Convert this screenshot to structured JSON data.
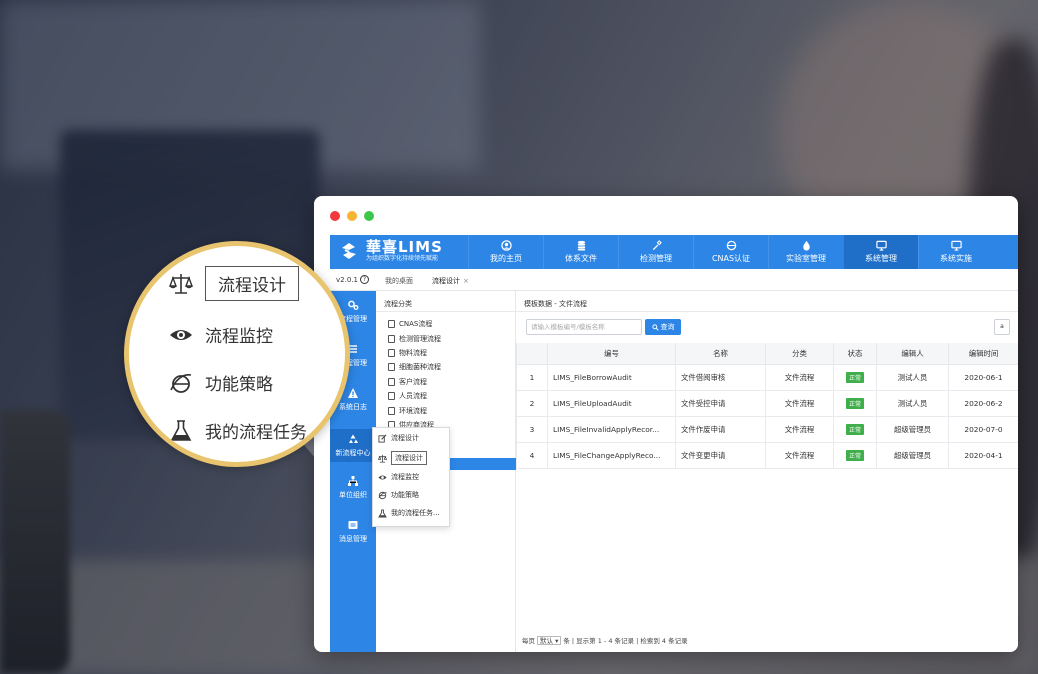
{
  "app": {
    "brand_name": "華喜LIMS",
    "brand_tagline": "为组织数字化持续领先赋能",
    "version": "v2.0.1",
    "help_icon": "?",
    "accent_color": "#2d86e6",
    "status_color": "#3fae4b"
  },
  "nav": [
    {
      "label": "我的主页",
      "icon": "user-icon"
    },
    {
      "label": "体系文件",
      "icon": "database-icon"
    },
    {
      "label": "检测管理",
      "icon": "pipette-icon"
    },
    {
      "label": "CNAS认证",
      "icon": "badge-icon"
    },
    {
      "label": "实验室管理",
      "icon": "drop-icon"
    },
    {
      "label": "系统管理",
      "icon": "monitor-icon",
      "active": true
    },
    {
      "label": "系统实施",
      "icon": "monitor-icon"
    }
  ],
  "tabs": [
    {
      "label": "我的桌面"
    },
    {
      "label": "流程设计",
      "close": "×"
    }
  ],
  "sidebar": [
    {
      "label": "流程管理",
      "icon": "gears-icon"
    },
    {
      "label": "流程管理",
      "icon": "list-icon"
    },
    {
      "label": "系统日志",
      "icon": "warning-icon"
    },
    {
      "label": "新流程中心",
      "icon": "recycle-icon",
      "active": true
    },
    {
      "label": "单位组织",
      "icon": "org-icon"
    },
    {
      "label": "消息管理",
      "icon": "message-icon"
    }
  ],
  "category_panel": {
    "title": "流程分类",
    "items": [
      "CNAS流程",
      "检测管理流程",
      "物料流程",
      "细胞菌种流程",
      "客户流程",
      "人员流程",
      "环境流程",
      "供应商流程"
    ]
  },
  "flyout": {
    "items": [
      {
        "label": "流程设计",
        "icon": "edit-icon"
      },
      {
        "label": "流程设计",
        "icon": "scale-icon",
        "boxed": true
      },
      {
        "label": "流程监控",
        "icon": "eye-icon"
      },
      {
        "label": "功能策略",
        "icon": "ie-icon"
      },
      {
        "label": "我的流程任务...",
        "icon": "flask-icon"
      }
    ]
  },
  "main": {
    "breadcrumb": "模板数据 - 文件流程",
    "search_placeholder": "请输入模板编号/模板名称",
    "search_button": "查询",
    "right_button": "a",
    "columns": [
      "",
      "编号",
      "名称",
      "分类",
      "状态",
      "编辑人",
      "编辑时间"
    ],
    "rows": [
      {
        "idx": "1",
        "code": "LIMS_FileBorrowAudit",
        "name": "文件借阅审核",
        "category": "文件流程",
        "status": "正常",
        "editor": "测试人员",
        "time": "2020-06-1"
      },
      {
        "idx": "2",
        "code": "LIMS_FileUploadAudit",
        "name": "文件受控申请",
        "category": "文件流程",
        "status": "正常",
        "editor": "测试人员",
        "time": "2020-06-2"
      },
      {
        "idx": "3",
        "code": "LIMS_FileInvalidApplyRecor...",
        "name": "文件作废申请",
        "category": "文件流程",
        "status": "正常",
        "editor": "超级管理员",
        "time": "2020-07-0"
      },
      {
        "idx": "4",
        "code": "LIMS_FileChangeApplyReco...",
        "name": "文件变更申请",
        "category": "文件流程",
        "status": "正常",
        "editor": "超级管理员",
        "time": "2020-04-1"
      }
    ],
    "pager": {
      "prefix": "每页",
      "size": "默认",
      "suffix": "条 | 显示第 1 - 4 条记录 | 检索到 4 条记录"
    }
  },
  "magnifier": {
    "accent_color": "#e7c46d",
    "items": [
      {
        "label": "流程设计",
        "icon": "scale-icon",
        "boxed": true
      },
      {
        "label": "流程监控",
        "icon": "eye-icon"
      },
      {
        "label": "功能策略",
        "icon": "ie-icon"
      },
      {
        "label": "我的流程任务",
        "icon": "flask-icon"
      }
    ]
  }
}
